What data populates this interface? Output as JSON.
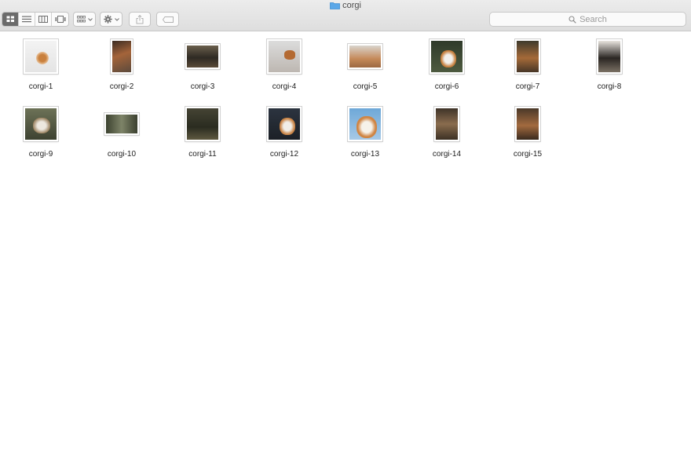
{
  "window": {
    "title": "corgi",
    "title_icon": "folder-icon"
  },
  "toolbar": {
    "view_modes": [
      {
        "name": "icon-view",
        "icon": "grid-icon",
        "active": true
      },
      {
        "name": "list-view",
        "icon": "list-icon",
        "active": false
      },
      {
        "name": "column-view",
        "icon": "columns-icon",
        "active": false
      },
      {
        "name": "gallery-view",
        "icon": "gallery-icon",
        "active": false
      }
    ],
    "group_icon": "group-by-icon",
    "action_icon": "gear-icon",
    "share_icon": "share-icon",
    "tag_icon": "tag-icon",
    "search": {
      "placeholder": "Search",
      "icon": "search-icon"
    }
  },
  "files": [
    {
      "name": "corgi-1"
    },
    {
      "name": "corgi-2"
    },
    {
      "name": "corgi-3"
    },
    {
      "name": "corgi-4"
    },
    {
      "name": "corgi-5"
    },
    {
      "name": "corgi-6"
    },
    {
      "name": "corgi-7"
    },
    {
      "name": "corgi-8"
    },
    {
      "name": "corgi-9"
    },
    {
      "name": "corgi-10"
    },
    {
      "name": "corgi-11"
    },
    {
      "name": "corgi-12"
    },
    {
      "name": "corgi-13"
    },
    {
      "name": "corgi-14"
    },
    {
      "name": "corgi-15"
    }
  ],
  "colors": {
    "toolbar_bg": "#e4e4e4",
    "active_view": "#6b6b6b",
    "folder_blue": "#5aa7e8"
  }
}
